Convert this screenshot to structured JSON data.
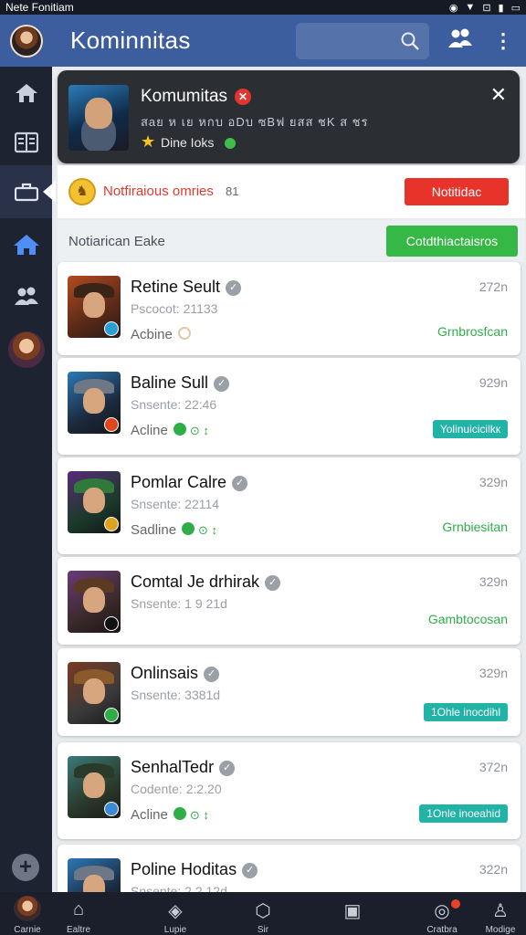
{
  "status_bar": {
    "left_text": "Nete Fonitiam"
  },
  "app_bar": {
    "title": "Kominnitas"
  },
  "banner": {
    "title": "Komumitas",
    "subtext": "สaย ห เย หกบ อDบ ซBฟ ยสส ชK ส ชร",
    "rating_text": "Dine Ioks"
  },
  "notification": {
    "text": "Notfiraious omries",
    "count": "81",
    "button_label": "Notitidac"
  },
  "subheader": {
    "text": "Notiarican Eake",
    "button_label": "Cotdthiactaisros"
  },
  "conversations": [
    {
      "name": "Retine Seult",
      "subtitle": "Pscocot: 21133",
      "status": "Acbine",
      "time": "272n",
      "action": "Grnbrosfcan",
      "action_style": "text",
      "has_pill": "ring",
      "has_extra": false
    },
    {
      "name": "Baline Sull",
      "subtitle": "Snsente: 22:46",
      "status": "Acline",
      "time": "929n",
      "action": "Yolinuicicilkк",
      "action_style": "pill",
      "has_pill": "green",
      "has_extra": true
    },
    {
      "name": "Pomlar Calre",
      "subtitle": "Snsente: 22114",
      "status": "Sadline",
      "time": "329n",
      "action": "Grnbiesitan",
      "action_style": "text",
      "has_pill": "green",
      "has_extra": true
    },
    {
      "name": "Comtal Je drhirak",
      "subtitle": "Snsente: 1 9 21d",
      "status": "",
      "time": "329n",
      "action": "Gambtocosan",
      "action_style": "text",
      "has_pill": "none",
      "has_extra": false
    },
    {
      "name": "Onlinsais",
      "subtitle": "Snsente: 3381d",
      "status": "",
      "time": "329n",
      "action": "1Ohle inocdihl",
      "action_style": "pill",
      "has_pill": "none",
      "has_extra": false
    },
    {
      "name": "SenhalTedr",
      "subtitle": "Codente: 2:2.20",
      "status": "Acline",
      "time": "372n",
      "action": "1Onle inoeahid",
      "action_style": "pill",
      "has_pill": "green",
      "has_extra": true
    },
    {
      "name": "Poline Hoditas",
      "subtitle": "Snsente: 2 2.12d",
      "status": "",
      "time": "322n",
      "action": "",
      "action_style": "none",
      "has_pill": "none",
      "has_extra": false
    }
  ],
  "tab_bar": {
    "items": [
      {
        "label": "Carnie",
        "icon": "avatar"
      },
      {
        "label": "Ealtre",
        "icon": "home-icon"
      },
      {
        "label": "Lupie",
        "icon": "diamond-icon"
      },
      {
        "label": "Sir",
        "icon": "shield-icon"
      },
      {
        "label": "",
        "icon": "image-icon"
      },
      {
        "label": "Cratbra",
        "icon": "people-icon"
      },
      {
        "label": "Modige",
        "icon": "person-icon"
      }
    ]
  },
  "colors": {
    "app_bar": "#3d5e9e",
    "sidebar": "#1d2331",
    "accent_red": "#e8332a",
    "accent_green": "#35b845",
    "accent_teal": "#21b3a6"
  }
}
